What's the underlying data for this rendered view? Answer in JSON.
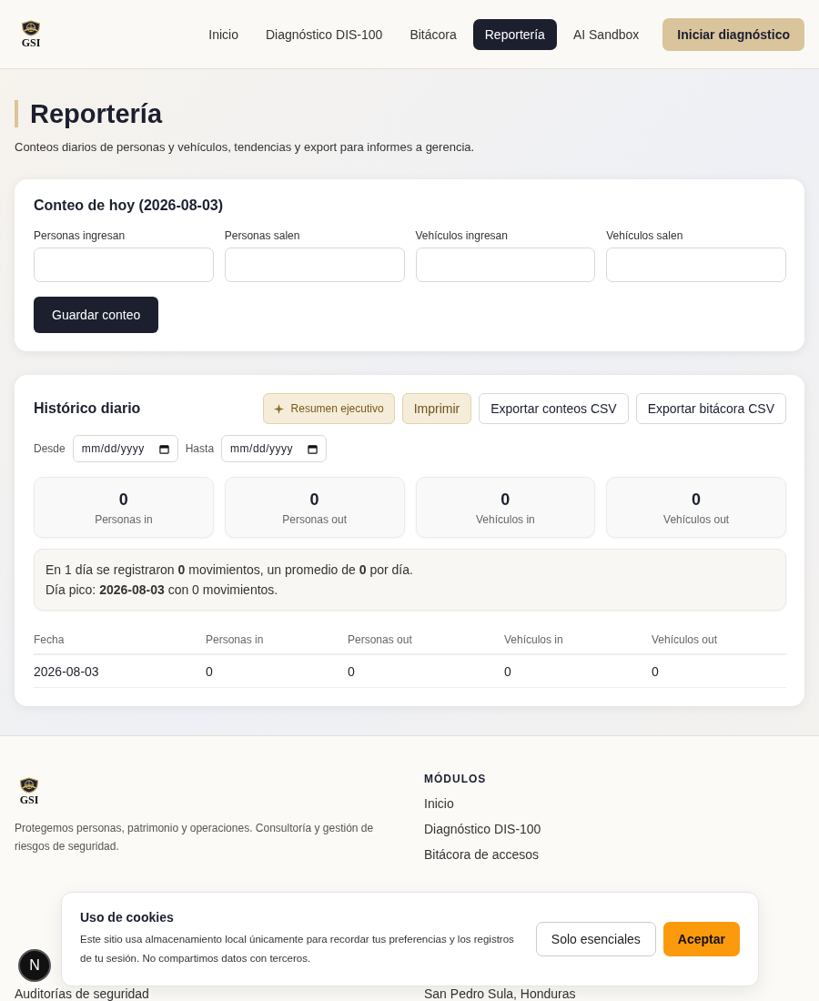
{
  "header": {
    "logo_text": "GSI",
    "nav": [
      {
        "label": "Inicio",
        "selected": false
      },
      {
        "label": "Diagnóstico DIS-100",
        "selected": false
      },
      {
        "label": "Bitácora",
        "selected": false
      },
      {
        "label": "Reportería",
        "selected": true
      },
      {
        "label": "AI Sandbox",
        "selected": false
      }
    ],
    "cta": "Iniciar diagnóstico"
  },
  "page": {
    "title": "Reportería",
    "subtitle": "Conteos diarios de personas y vehículos, tendencias y export para informes a gerencia."
  },
  "count_card": {
    "title": "Conteo de hoy (2026-08-03)",
    "fields": [
      {
        "label": "Personas ingresan"
      },
      {
        "label": "Personas salen"
      },
      {
        "label": "Vehículos ingresan"
      },
      {
        "label": "Vehículos salen"
      }
    ],
    "button": "Guardar conteo"
  },
  "history": {
    "title": "Histórico diario",
    "actions": [
      {
        "label": "Resumen ejecutivo",
        "kind": "sparkle"
      },
      {
        "label": "Imprimir",
        "kind": "accent"
      },
      {
        "label": "Exportar conteos CSV",
        "kind": "outline"
      },
      {
        "label": "Exportar bitácora CSV",
        "kind": "outline"
      }
    ],
    "filters": [
      {
        "label": "Desde",
        "value": "mm/dd/yyyy"
      },
      {
        "label": "Hasta",
        "value": "mm/dd/yyyy"
      }
    ],
    "stats": [
      {
        "value": "0",
        "label": "Personas in"
      },
      {
        "value": "0",
        "label": "Personas out"
      },
      {
        "value": "0",
        "label": "Vehículos in"
      },
      {
        "value": "0",
        "label": "Vehículos out"
      }
    ],
    "summary": [
      "En 1 día se registraron **0** movimientos, un promedio de **0** por día.",
      "Día pico: **2026-08-03** con 0 movimientos."
    ],
    "table": {
      "columns": [
        "Fecha",
        "Personas in",
        "Personas out",
        "Vehículos in",
        "Vehículos out"
      ],
      "rows": [
        [
          "2026-08-03",
          "0",
          "0",
          "0",
          "0"
        ]
      ]
    }
  },
  "footer": {
    "logo_text": "GSI",
    "description": "Protegemos personas, patrimonio y operaciones. Consultoría y gestión de riesgos de seguridad.",
    "modules": {
      "heading": "MÓDULOS",
      "links": [
        "Inicio",
        "Diagnóstico DIS-100",
        "Bitácora de accesos"
      ]
    },
    "services": {
      "links": [
        "Auditorías de seguridad"
      ]
    },
    "contact": {
      "lines": [
        "San Pedro Sula, Honduras"
      ]
    }
  },
  "cookie_banner": {
    "title": "Uso de cookies",
    "text": "Este sitio usa almacenamiento local únicamente para recordar tus preferencias y los registros de tu sesión. No compartimos datos con terceros.",
    "buttons": [
      {
        "label": "Solo esenciales",
        "kind": "outline"
      },
      {
        "label": "Aceptar",
        "kind": "primary"
      }
    ]
  },
  "dev_badge": {
    "label": "N"
  }
}
